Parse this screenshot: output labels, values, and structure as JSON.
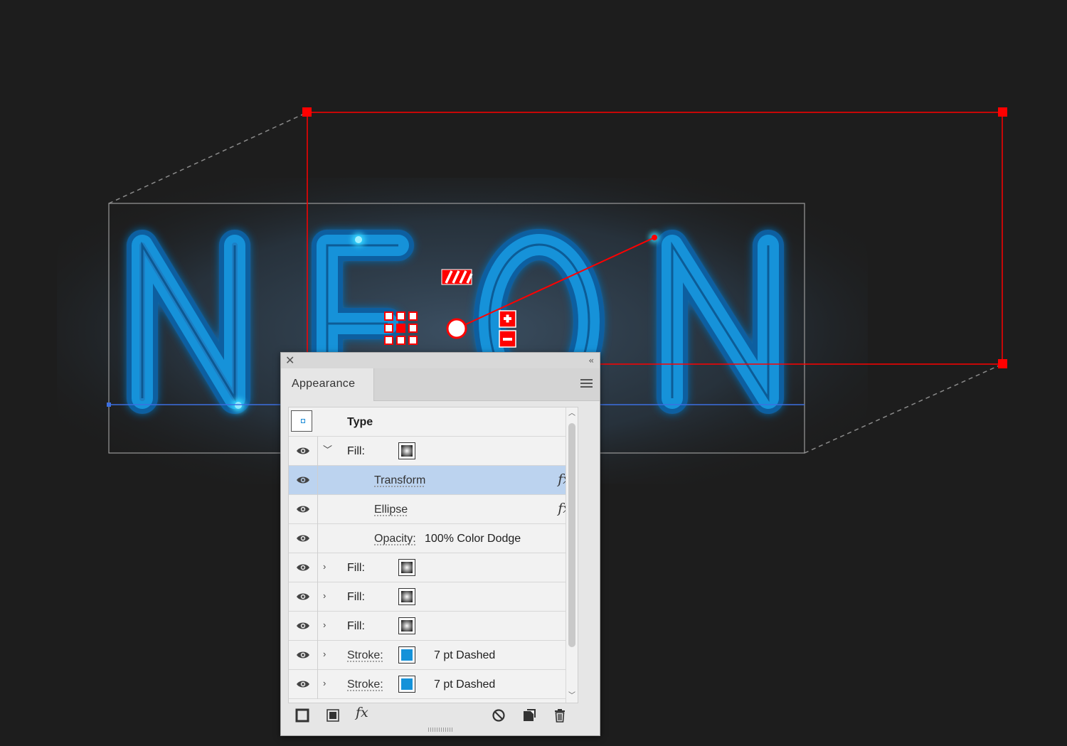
{
  "canvas": {
    "background": "#1d1d1d",
    "artwork_text": "NEON",
    "neon_color": "#1592d9",
    "selection_color": "#ff0000",
    "baseline_color": "#3c6fe0"
  },
  "panel": {
    "close_icon": "close-icon",
    "collapse_icon": "collapse-icon",
    "tab_label": "Appearance",
    "menu_icon": "panel-menu-icon",
    "rows": [
      {
        "kind": "header",
        "label": "Type"
      },
      {
        "kind": "attribute",
        "label": "Fill:",
        "expanded": true,
        "swatch": "gradient"
      },
      {
        "kind": "effect",
        "label": "Transform",
        "selected": true,
        "fx_label": "fx"
      },
      {
        "kind": "effect",
        "label": "Ellipse",
        "fx_label": "fx"
      },
      {
        "kind": "opacity",
        "label": "Opacity:",
        "value": "100% Color Dodge"
      },
      {
        "kind": "attribute",
        "label": "Fill:",
        "swatch": "gradient"
      },
      {
        "kind": "attribute",
        "label": "Fill:",
        "swatch": "gradient"
      },
      {
        "kind": "attribute",
        "label": "Fill:",
        "swatch": "gradient"
      },
      {
        "kind": "stroke",
        "label": "Stroke:",
        "swatch": "blue",
        "value": "7 pt Dashed"
      },
      {
        "kind": "stroke",
        "label": "Stroke:",
        "swatch": "blue",
        "value": "7 pt Dashed"
      }
    ],
    "footer_icons": [
      "add-new-stroke-icon",
      "add-new-fill-icon",
      "add-effect-icon",
      "clear-appearance-icon",
      "duplicate-item-icon",
      "delete-icon"
    ],
    "fx_footer_label": "fx"
  }
}
